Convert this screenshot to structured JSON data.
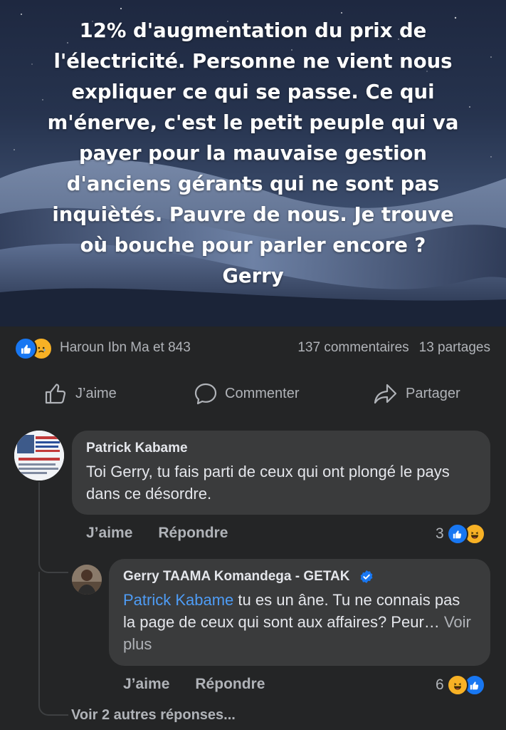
{
  "post": {
    "text": "12% d'augmentation du prix de\nl'électricité. Personne ne vient nous\nexpliquer ce qui se passe. Ce qui\nm'énerve, c'est le petit peuple qui va\npayer pour la mauvaise gestion\nd'anciens gérants qui ne sont pas\ninquiètés. Pauvre de nous. Je trouve\noù bouche pour parler encore ?\nGerry"
  },
  "stats": {
    "reactions_icons": [
      "like-icon",
      "sad-icon"
    ],
    "likers": "Haroun Ibn Ma et 843",
    "comments": "137 commentaires",
    "shares": "13 partages"
  },
  "actions": {
    "like": "J’aime",
    "comment": "Commenter",
    "share": "Partager"
  },
  "comments": [
    {
      "author": "Patrick Kabame",
      "text": "Toi Gerry, tu fais parti de ceux qui ont plongé le pays dans ce désordre.",
      "like_label": "J’aime",
      "reply_label": "Répondre",
      "reaction_count": "3",
      "reaction_icons": [
        "like-icon",
        "haha-icon"
      ]
    }
  ],
  "reply": {
    "author": "Gerry TAAMA Komandega - GETAK",
    "verified": true,
    "mention": "Patrick Kabame",
    "text": " tu es un âne. Tu ne connais pas la page de ceux qui sont aux affaires? Peur…",
    "see_more": "Voir plus",
    "like_label": "J’aime",
    "reply_label": "Répondre",
    "reaction_count": "6",
    "reaction_icons": [
      "haha-icon",
      "like-icon"
    ]
  },
  "more_replies": "Voir 2 autres réponses...",
  "colors": {
    "background": "#242526",
    "bubble": "#3a3b3c",
    "accent": "#1877f2",
    "mention": "#4e9cf5",
    "muted": "#b0b3b8"
  }
}
